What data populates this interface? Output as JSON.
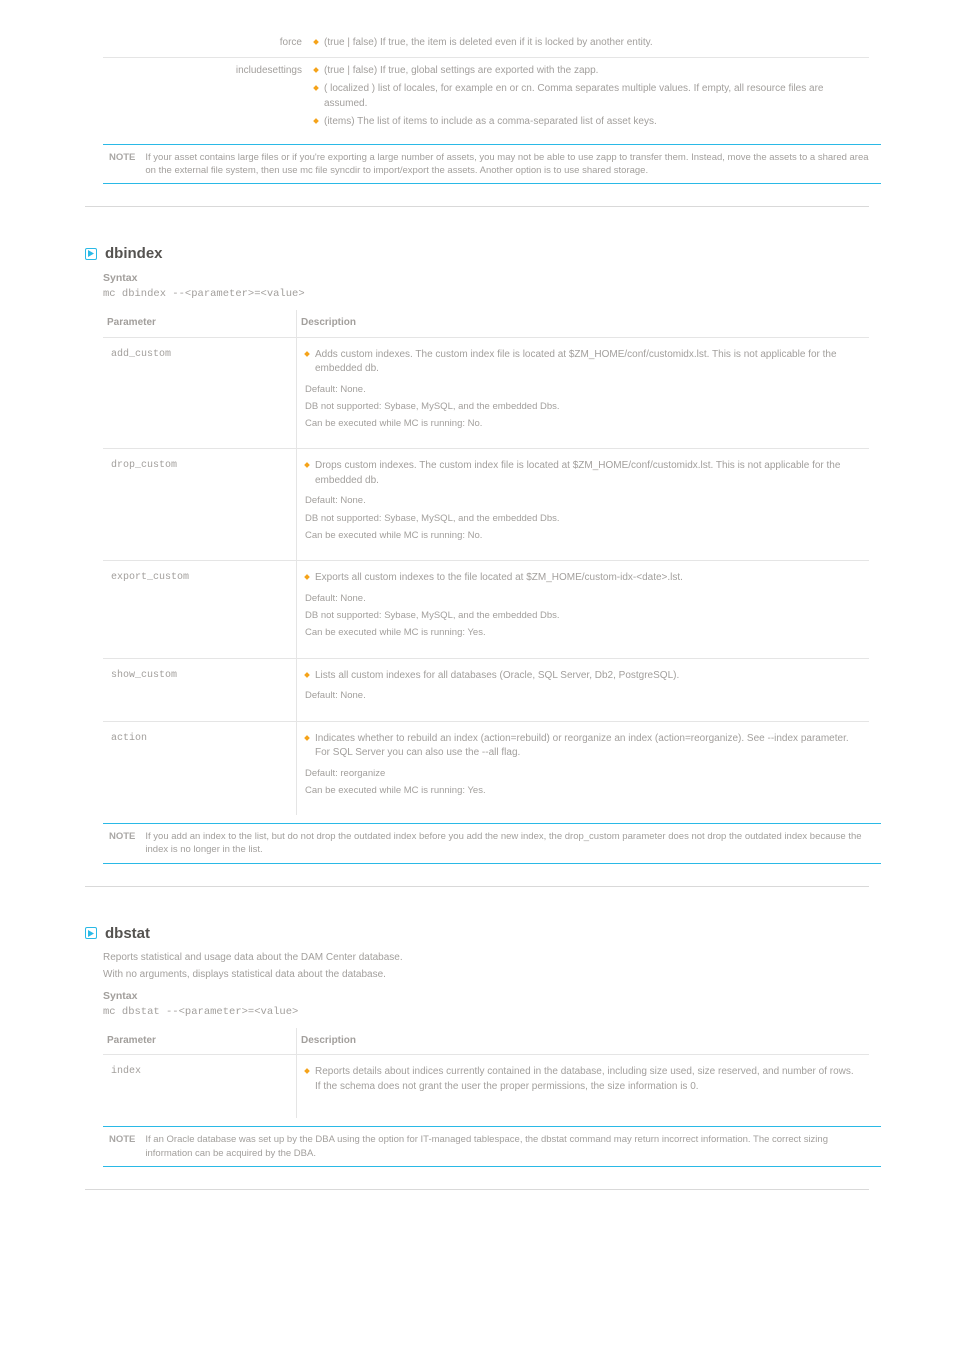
{
  "top_section": {
    "rows": [
      {
        "label": "force",
        "items": [
          {
            "text": "(true | false) If true, the item is deleted even if it is locked by another entity."
          }
        ]
      },
      {
        "label": "includesettings",
        "items": [
          {
            "text": "(true | false) If true, global settings are exported with the zapp."
          },
          {
            "text": "( localized ) list of locales, for example en or cn. Comma separates multiple values. If empty, all resource files are assumed."
          },
          {
            "text": "(items) The list of items to include as a comma-separated list of asset keys."
          }
        ]
      }
    ],
    "note_label": "NOTE",
    "note_body": "If your asset contains large files or if you're exporting a large number of assets, you may not be able to use zapp to transfer them. Instead, move the assets to a shared area on the external file system, then use mc file syncdir to import/export the assets. Another option is to use shared storage.",
    "close_sep": true
  },
  "sections": [
    {
      "id": "dbindex",
      "title": "dbindex",
      "syntax_label": "Syntax",
      "syntax_code": "mc dbindex --<parameter>=<value>",
      "table_headers": {
        "param": "Parameter",
        "desc": "Description"
      },
      "params": [
        {
          "name": "add_custom",
          "desc": "Adds custom indexes. The custom index file is located at $ZM_HOME/conf/customidx.lst. This is not applicable for the embedded db.",
          "default": "Default: None.",
          "extras": [
            "DB not supported: Sybase, MySQL, and the embedded Dbs.",
            "Can be executed while MC is running: No."
          ]
        },
        {
          "name": "drop_custom",
          "desc": "Drops custom indexes. The custom index file is located at $ZM_HOME/conf/customidx.lst. This is not applicable for the embedded db.",
          "default": "Default: None.",
          "extras": [
            "DB not supported: Sybase, MySQL, and the embedded Dbs.",
            "Can be executed while MC is running: No."
          ]
        },
        {
          "name": "export_custom",
          "desc": "Exports all custom indexes to the file located at $ZM_HOME/custom-idx-<date>.lst.",
          "default": "Default: None.",
          "extras": [
            "DB not supported: Sybase, MySQL, and the embedded Dbs.",
            "Can be executed while MC is running: Yes."
          ]
        },
        {
          "name": "show_custom",
          "desc": "Lists all custom indexes for all databases (Oracle, SQL Server, Db2, PostgreSQL).",
          "default": "Default: None.",
          "extras": []
        },
        {
          "name": "action",
          "desc": "Indicates whether to rebuild an index (action=rebuild) or reorganize an index (action=reorganize). See --index parameter. For SQL Server you can also use the --all flag.",
          "default": "Default: reorganize",
          "extras": [
            "Can be executed while MC is running: Yes."
          ]
        }
      ],
      "note_label": "NOTE",
      "note_body": "If you add an index to the list, but do not drop the outdated index before you add the new index, the drop_custom parameter does not drop the outdated index because the index is no longer in the list."
    },
    {
      "id": "dbstat",
      "title": "dbstat",
      "intro": "Reports statistical and usage data about the DAM Center database.",
      "subintro": "With no arguments, displays statistical data about the database.",
      "syntax_label": "Syntax",
      "syntax_code": "mc dbstat --<parameter>=<value>",
      "table_headers": {
        "param": "Parameter",
        "desc": "Description"
      },
      "params": [
        {
          "name": "index",
          "desc": "Reports details about indices currently contained in the database, including size used, size reserved, and number of rows. If the schema does not grant the user the proper permissions, the size information is 0.",
          "default": "",
          "extras": []
        }
      ],
      "note_label": "NOTE",
      "note_body": "If an Oracle database was set up by the DBA using the option for IT-managed tablespace, the dbstat command may return incorrect information. The correct sizing information can be acquired by the DBA."
    }
  ]
}
